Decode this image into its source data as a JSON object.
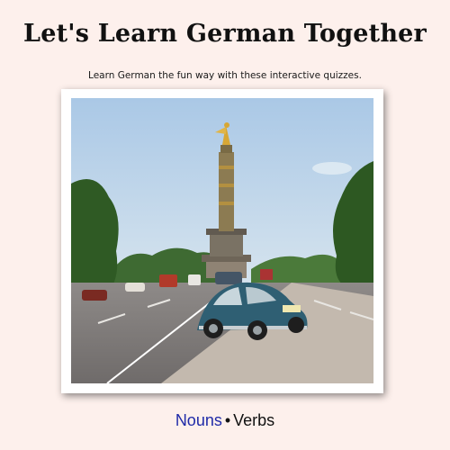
{
  "header": {
    "title": "Let's Learn German Together",
    "subtitle": "Learn German the fun way with these interactive quizzes."
  },
  "nav": {
    "nouns_label": "Nouns",
    "separator": "•",
    "verbs_label": "Verbs"
  },
  "colors": {
    "background": "#fdf0ec",
    "link_active": "#1f2aa8"
  }
}
